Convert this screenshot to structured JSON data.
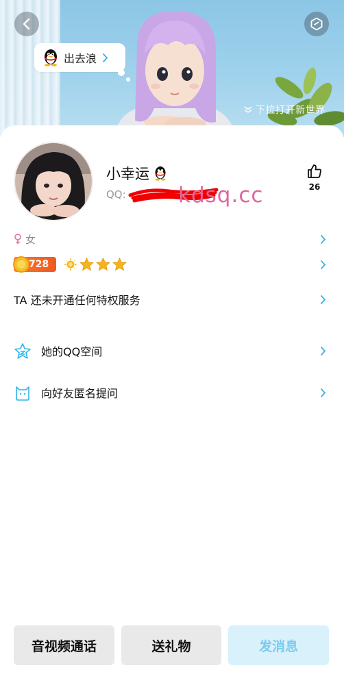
{
  "header": {
    "bubble_text": "出去浪",
    "pull_hint": "下拉打开新世界"
  },
  "profile": {
    "nickname": "小幸运",
    "qq_label": "QQ:",
    "watermark": "kdsq.cc",
    "like_count": "26",
    "gender": "女",
    "level": "728",
    "level_icons": [
      "sun-icon",
      "star-icon",
      "star-icon",
      "star-icon"
    ]
  },
  "rows": {
    "privilege": "TA 还未开通任何特权服务",
    "qzone": "她的QQ空间",
    "anonymous_ask": "向好友匿名提问"
  },
  "bottom_bar": {
    "call": "音视频通话",
    "gift": "送礼物",
    "message": "发消息"
  },
  "colors": {
    "accent": "#2fb4e8",
    "primary_button_bg": "#d9f1fb",
    "primary_button_text": "#7ccbf0",
    "gender_female": "#e86ea8",
    "level_badge": "#f06a26",
    "star": "#f5b51a"
  }
}
